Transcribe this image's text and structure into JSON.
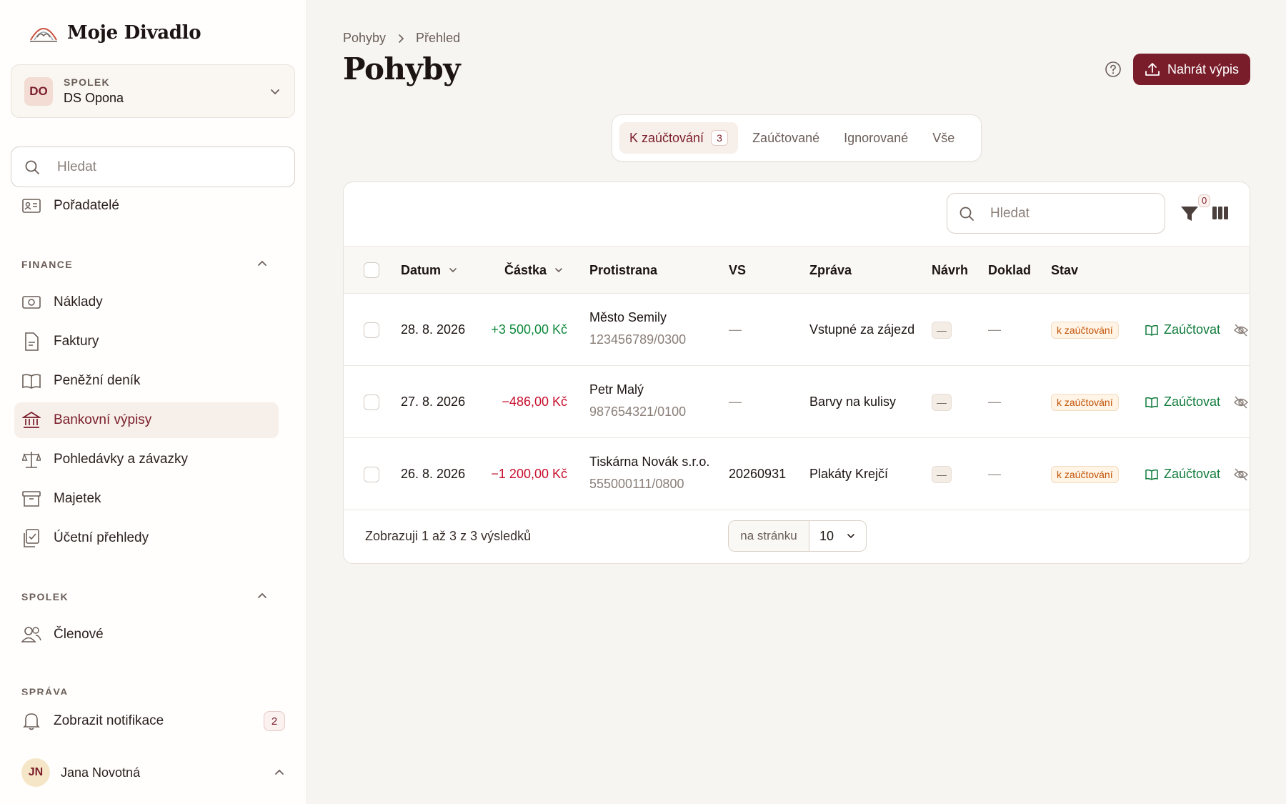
{
  "app": {
    "name": "Moje Divadlo"
  },
  "org": {
    "kicker": "SPOLEK",
    "name": "DS Opona",
    "initials": "DO"
  },
  "sidebar": {
    "search_placeholder": "Hledat",
    "top_item": "Pořadatelé",
    "finance_label": "FINANCE",
    "finance_items": [
      "Náklady",
      "Faktury",
      "Peněžní deník",
      "Bankovní výpisy",
      "Pohledávky a závazky",
      "Majetek",
      "Účetní přehledy"
    ],
    "spolek_label": "SPOLEK",
    "spolek_items": [
      "Členové"
    ],
    "cut_label": "SPRÁVA",
    "notifications_label": "Zobrazit notifikace",
    "notifications_count": "2",
    "user": {
      "initials": "JN",
      "name": "Jana Novotná"
    }
  },
  "breadcrumb": [
    "Pohyby",
    "Přehled"
  ],
  "page": {
    "title": "Pohyby",
    "upload_label": "Nahrát výpis"
  },
  "tabs": [
    {
      "label": "K zaúčtování",
      "count": "3",
      "active": true
    },
    {
      "label": "Zaúčtované"
    },
    {
      "label": "Ignorované"
    },
    {
      "label": "Vše"
    }
  ],
  "table": {
    "search_placeholder": "Hledat",
    "filter_count": "0",
    "headers": [
      "Datum",
      "Částka",
      "Protistrana",
      "VS",
      "Zpráva",
      "Návrh",
      "Doklad",
      "Stav"
    ],
    "rows": [
      {
        "date": "28. 8. 2026",
        "amount": "+3 500,00 Kč",
        "sign": "pos",
        "party": "Město Semily",
        "account": "123456789/0300",
        "vs": "—",
        "message": "Vstupné za zájezd",
        "navrh": "—",
        "doklad": "—",
        "status": "k zaúčtování",
        "action": "Zaúčtovat"
      },
      {
        "date": "27. 8. 2026",
        "amount": "−486,00 Kč",
        "sign": "neg",
        "party": "Petr Malý",
        "account": "987654321/0100",
        "vs": "—",
        "message": "Barvy na kulisy",
        "navrh": "—",
        "doklad": "—",
        "status": "k zaúčtování",
        "action": "Zaúčtovat"
      },
      {
        "date": "26. 8. 2026",
        "amount": "−1 200,00 Kč",
        "sign": "neg",
        "party": "Tiskárna Novák s.r.o.",
        "account": "555000111/0800",
        "vs": "20260931",
        "message": "Plakáty Krejčí",
        "navrh": "—",
        "doklad": "—",
        "status": "k zaúčtování",
        "action": "Zaúčtovat"
      }
    ],
    "footer_text": "Zobrazuji 1 až 3 z 3 výsledků",
    "per_page_label": "na stránku",
    "per_page_value": "10"
  }
}
